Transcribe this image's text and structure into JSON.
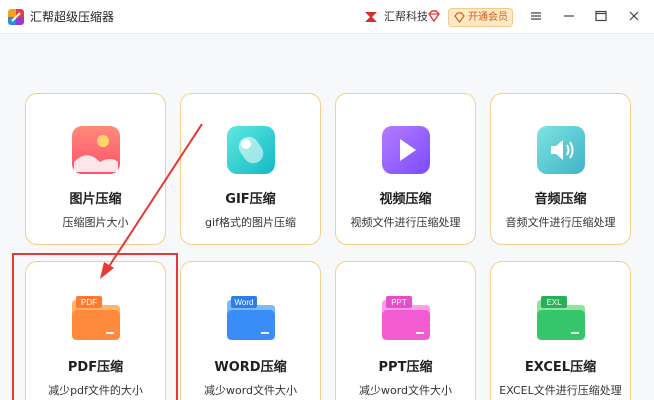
{
  "titlebar": {
    "app_title": "汇帮超级压缩器",
    "brand_name": "汇帮科技",
    "vip_label": "开通会员"
  },
  "cards": [
    {
      "title": "图片压缩",
      "desc": "压缩图片大小",
      "icon": "image-icon"
    },
    {
      "title": "GIF压缩",
      "desc": "gif格式的图片压缩",
      "icon": "gif-icon"
    },
    {
      "title": "视频压缩",
      "desc": "视频文件进行压缩处理",
      "icon": "video-icon"
    },
    {
      "title": "音频压缩",
      "desc": "音频文件进行压缩处理",
      "icon": "audio-icon"
    },
    {
      "title": "PDF压缩",
      "desc": "减少pdf文件的大小",
      "icon": "pdf-folder-icon",
      "tag": "PDF"
    },
    {
      "title": "WORD压缩",
      "desc": "减少word文件大小",
      "icon": "word-folder-icon",
      "tag": "Word"
    },
    {
      "title": "PPT压缩",
      "desc": "减少word文件大小",
      "icon": "ppt-folder-icon",
      "tag": "PPT"
    },
    {
      "title": "EXCEL压缩",
      "desc": "EXCEL文件进行压缩处理",
      "icon": "excel-folder-icon",
      "tag": "EXL"
    }
  ],
  "colors": {
    "accent_border": "#f4ce8b",
    "highlight": "#e53935",
    "vip_text": "#d0601a"
  }
}
